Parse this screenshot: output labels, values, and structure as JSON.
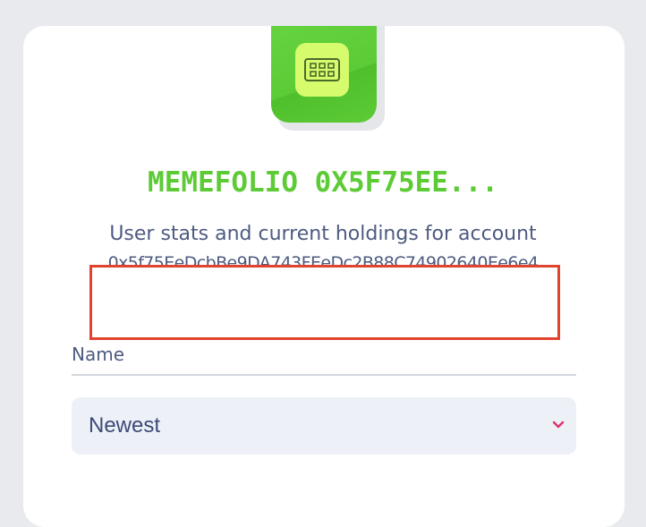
{
  "header": {
    "title": "MEMEFOLIO 0X5F75EE...",
    "subtitle": "User stats and current holdings for account",
    "account_address": "0x5f75EeDcbBe9DA743FEeDc2B88C74902640Ee6e4"
  },
  "filters": {
    "name_placeholder": "Name",
    "sort_selected": "Newest"
  },
  "colors": {
    "brand_green": "#5ccb36",
    "logo_inner": "#d6fb6c",
    "text_primary": "#4d5b80",
    "highlight_border": "#e2432f",
    "chevron": "#e0306e"
  },
  "icons": {
    "logo": "grid-icon",
    "sort_dropdown": "chevron-down-icon"
  }
}
